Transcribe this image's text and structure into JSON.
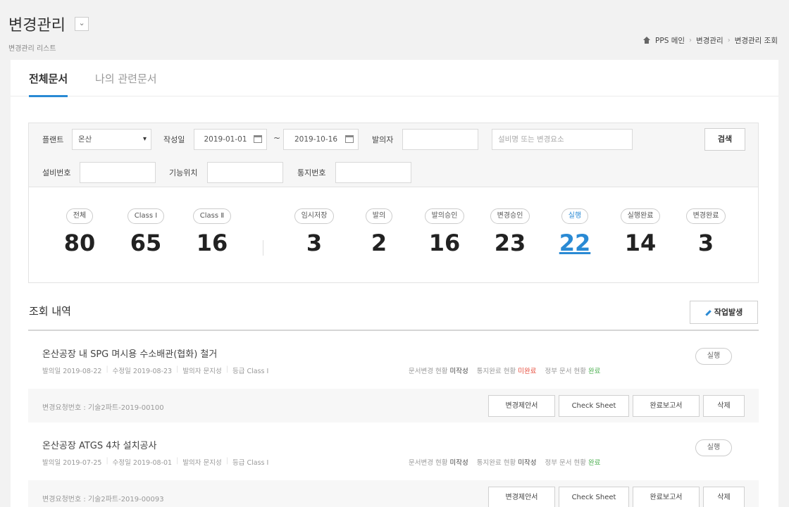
{
  "header": {
    "title": "변경관리",
    "subtitle": "변경관리 리스트",
    "breadcrumb": [
      "PPS 메인",
      "변경관리",
      "변경관리 조회"
    ]
  },
  "tabs": [
    {
      "label": "전체문서",
      "active": true
    },
    {
      "label": "나의 관련문서",
      "active": false
    }
  ],
  "filters": {
    "plant_label": "플랜트",
    "plant_value": "온산",
    "date_label": "작성일",
    "date_from": "2019-01-01",
    "date_to": "2019-10-16",
    "requester_label": "발의자",
    "requester_value": "",
    "keyword_placeholder": "설비명 또는 변경요소",
    "search_label": "검색",
    "equip_label": "설비번호",
    "location_label": "기능위치",
    "notice_label": "통지번호"
  },
  "stats": [
    {
      "label": "전체",
      "value": "80"
    },
    {
      "label": "Class Ⅰ",
      "value": "65"
    },
    {
      "label": "Class Ⅱ",
      "value": "16"
    },
    {
      "label": "임시저장",
      "value": "3"
    },
    {
      "label": "발의",
      "value": "2"
    },
    {
      "label": "발의승인",
      "value": "16"
    },
    {
      "label": "변경승인",
      "value": "23"
    },
    {
      "label": "실행",
      "value": "22",
      "active": true
    },
    {
      "label": "실행완료",
      "value": "14"
    },
    {
      "label": "변경완료",
      "value": "3"
    }
  ],
  "list": {
    "title": "조회 내역",
    "work_button": "작업발생",
    "doc_buttons": [
      "변경제안서",
      "Check Sheet",
      "완료보고서",
      "삭제"
    ],
    "items": [
      {
        "title": "온산공장 내 SPG 며시용 수소배관(협화) 철거",
        "date_requested": "발의일 2019-08-22",
        "date_modified": "수정일 2019-08-23",
        "requester": "발의자 문지성",
        "grade": "등급 Class Ⅰ",
        "doc_status_label": "문서변경 현황",
        "doc_status_value": "미작성",
        "notify_label": "통지완료 현황",
        "notify_value": "미완료",
        "proj_label": "정부 문서 현황",
        "proj_value": "완료",
        "status": "실행",
        "code": "변경요청번호 : 기술2파트-2019-00100"
      },
      {
        "title": "온산공장 ATGS 4차 설치공사",
        "date_requested": "발의일 2019-07-25",
        "date_modified": "수정일 2019-08-01",
        "requester": "발의자 문지성",
        "grade": "등급 Class Ⅰ",
        "doc_status_label": "문서변경 현황",
        "doc_status_value": "미작성",
        "notify_label": "통지완료 현황",
        "notify_value": "미작성",
        "proj_label": "정부 문서 현황",
        "proj_value": "완료",
        "status": "실행",
        "code": "변경요청번호 : 기술2파트-2019-00093"
      }
    ]
  },
  "colors": {
    "accent": "#2a8ad4",
    "red": "#e74c3c",
    "green": "#4caf50"
  }
}
